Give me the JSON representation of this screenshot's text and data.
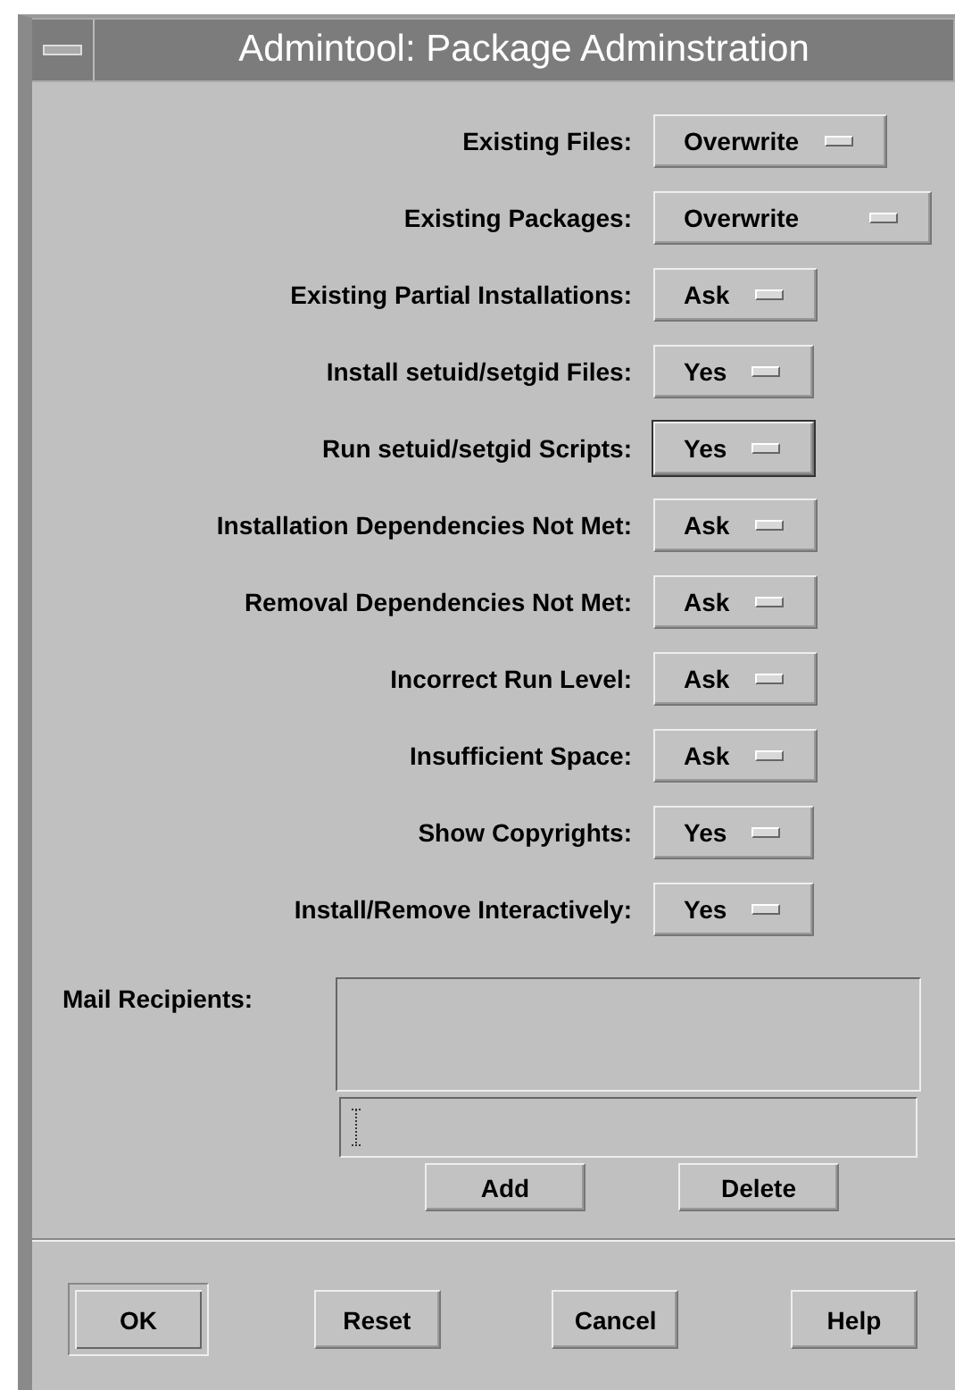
{
  "window": {
    "title": "Admintool: Package Adminstration"
  },
  "options": [
    {
      "label": "Existing Files:",
      "value": "Overwrite",
      "focused": false
    },
    {
      "label": "Existing Packages:",
      "value": "Overwrite",
      "focused": false
    },
    {
      "label": "Existing Partial Installations:",
      "value": "Ask",
      "focused": false
    },
    {
      "label": "Install setuid/setgid Files:",
      "value": "Yes",
      "focused": false
    },
    {
      "label": "Run setuid/setgid Scripts:",
      "value": "Yes",
      "focused": true
    },
    {
      "label": "Installation Dependencies Not Met:",
      "value": "Ask",
      "focused": false
    },
    {
      "label": "Removal Dependencies Not Met:",
      "value": "Ask",
      "focused": false
    },
    {
      "label": "Incorrect Run Level:",
      "value": "Ask",
      "focused": false
    },
    {
      "label": "Insufficient Space:",
      "value": "Ask",
      "focused": false
    },
    {
      "label": "Show Copyrights:",
      "value": "Yes",
      "focused": false
    },
    {
      "label": "Install/Remove Interactively:",
      "value": "Yes",
      "focused": false
    }
  ],
  "mail": {
    "label": "Mail Recipients:",
    "buttons": [
      "Add",
      "Delete"
    ]
  },
  "buttons": [
    {
      "label": "OK",
      "default": true
    },
    {
      "label": "Reset",
      "default": false
    },
    {
      "label": "Cancel",
      "default": false
    },
    {
      "label": "Help",
      "default": false
    }
  ]
}
